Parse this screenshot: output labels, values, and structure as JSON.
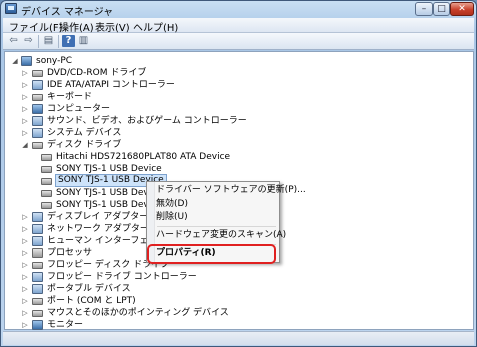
{
  "window": {
    "title": "デバイス マネージャ",
    "buttons": {
      "minimize": "–",
      "maximize": "□",
      "close": "✕"
    }
  },
  "menubar": {
    "items": [
      "ファイル(F)",
      "操作(A)",
      "表示(V)",
      "ヘルプ(H)"
    ]
  },
  "toolbar": {
    "icons": [
      "back-arrow-icon",
      "forward-arrow-icon",
      "console-tree-icon",
      "help-icon",
      "properties-icon"
    ],
    "glyphs": {
      "back": "⇦",
      "forward": "⇨",
      "tree": "▤",
      "help": "?",
      "props": "▥"
    }
  },
  "tree": {
    "root": "sony-PC",
    "nodes": {
      "dvd": "DVD/CD-ROM ドライブ",
      "ide": "IDE ATA/ATAPI コントローラー",
      "keyboard": "キーボード",
      "computer": "コンピューター",
      "sound": "サウンド、ビデオ、およびゲーム コントローラー",
      "system": "システム デバイス",
      "disk": "ディスク ドライブ",
      "disk_child_1": "Hitachi HDS721680PLAT80 ATA Device",
      "disk_child_2": "SONY TJS-1 USB Device",
      "disk_child_3": "SONY TJS-1 USB Device",
      "disk_child_4": "SONY TJS-1 USB Device",
      "disk_child_5": "SONY TJS-1 USB Device",
      "display": "ディスプレイ アダプター",
      "network": "ネットワーク アダプター",
      "hid": "ヒューマン インターフェイス",
      "processor": "プロセッサ",
      "floppy_disk": "フロッピー ディスク ドライブ",
      "floppy_ctrl": "フロッピー ドライブ コントローラー",
      "portable": "ポータブル デバイス",
      "ports": "ポート (COM と LPT)",
      "mouse": "マウスとそのほかのポインティング デバイス",
      "monitor": "モニター"
    },
    "expander_collapsed": "▷",
    "expander_expanded": "◢"
  },
  "context_menu": {
    "update_driver": "ドライバー ソフトウェアの更新(P)...",
    "disable": "無効(D)",
    "uninstall": "削除(U)",
    "scan": "ハードウェア変更のスキャン(A)",
    "properties": "プロパティ(R)"
  },
  "colors": {
    "highlight": "#e02020",
    "selection": "#cde3fa"
  }
}
